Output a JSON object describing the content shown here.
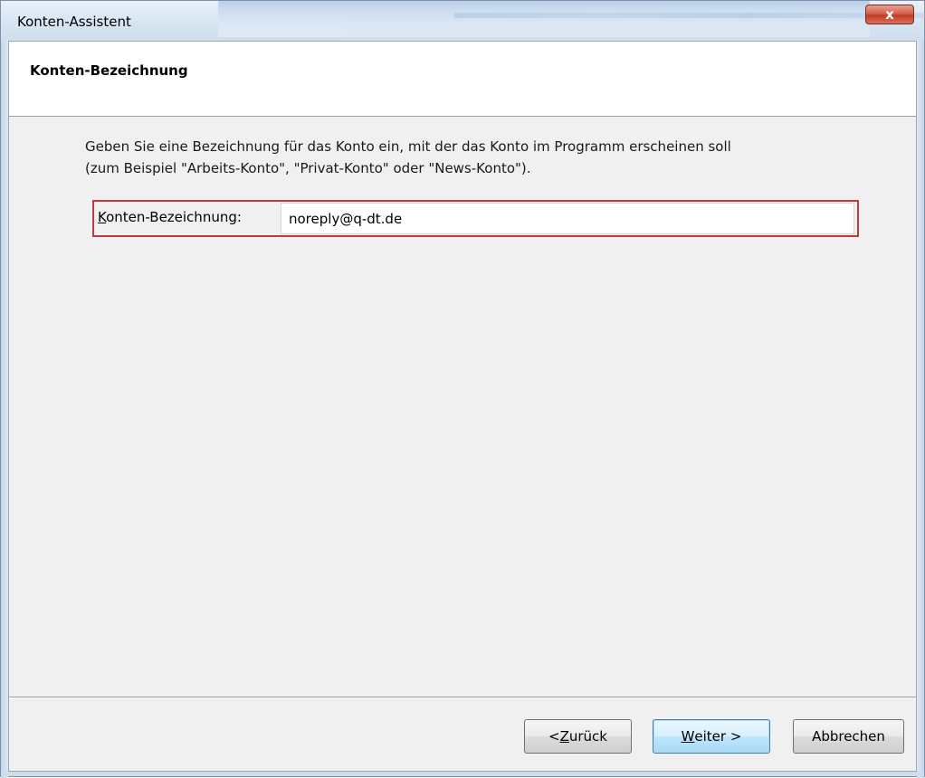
{
  "window": {
    "title": "Konten-Assistent",
    "close_glyph": "x",
    "close_icon": "close-icon"
  },
  "header": {
    "title": "Konten-Bezeichnung"
  },
  "content": {
    "description_line1": "Geben Sie eine Bezeichnung für das Konto ein, mit der das Konto im Programm erscheinen soll",
    "description_line2": "(zum Beispiel \"Arbeits-Konto\", \"Privat-Konto\" oder \"News-Konto\").",
    "field_label_first": "K",
    "field_label_rest": "onten-Bezeichnung:",
    "field_value": "noreply@q-dt.de",
    "highlight_color": "#c0393f"
  },
  "buttons": {
    "back_prefix": "< ",
    "back_accel": "Z",
    "back_rest": "urück",
    "next_accel": "W",
    "next_rest": "eiter >",
    "cancel": "Abbrechen"
  }
}
